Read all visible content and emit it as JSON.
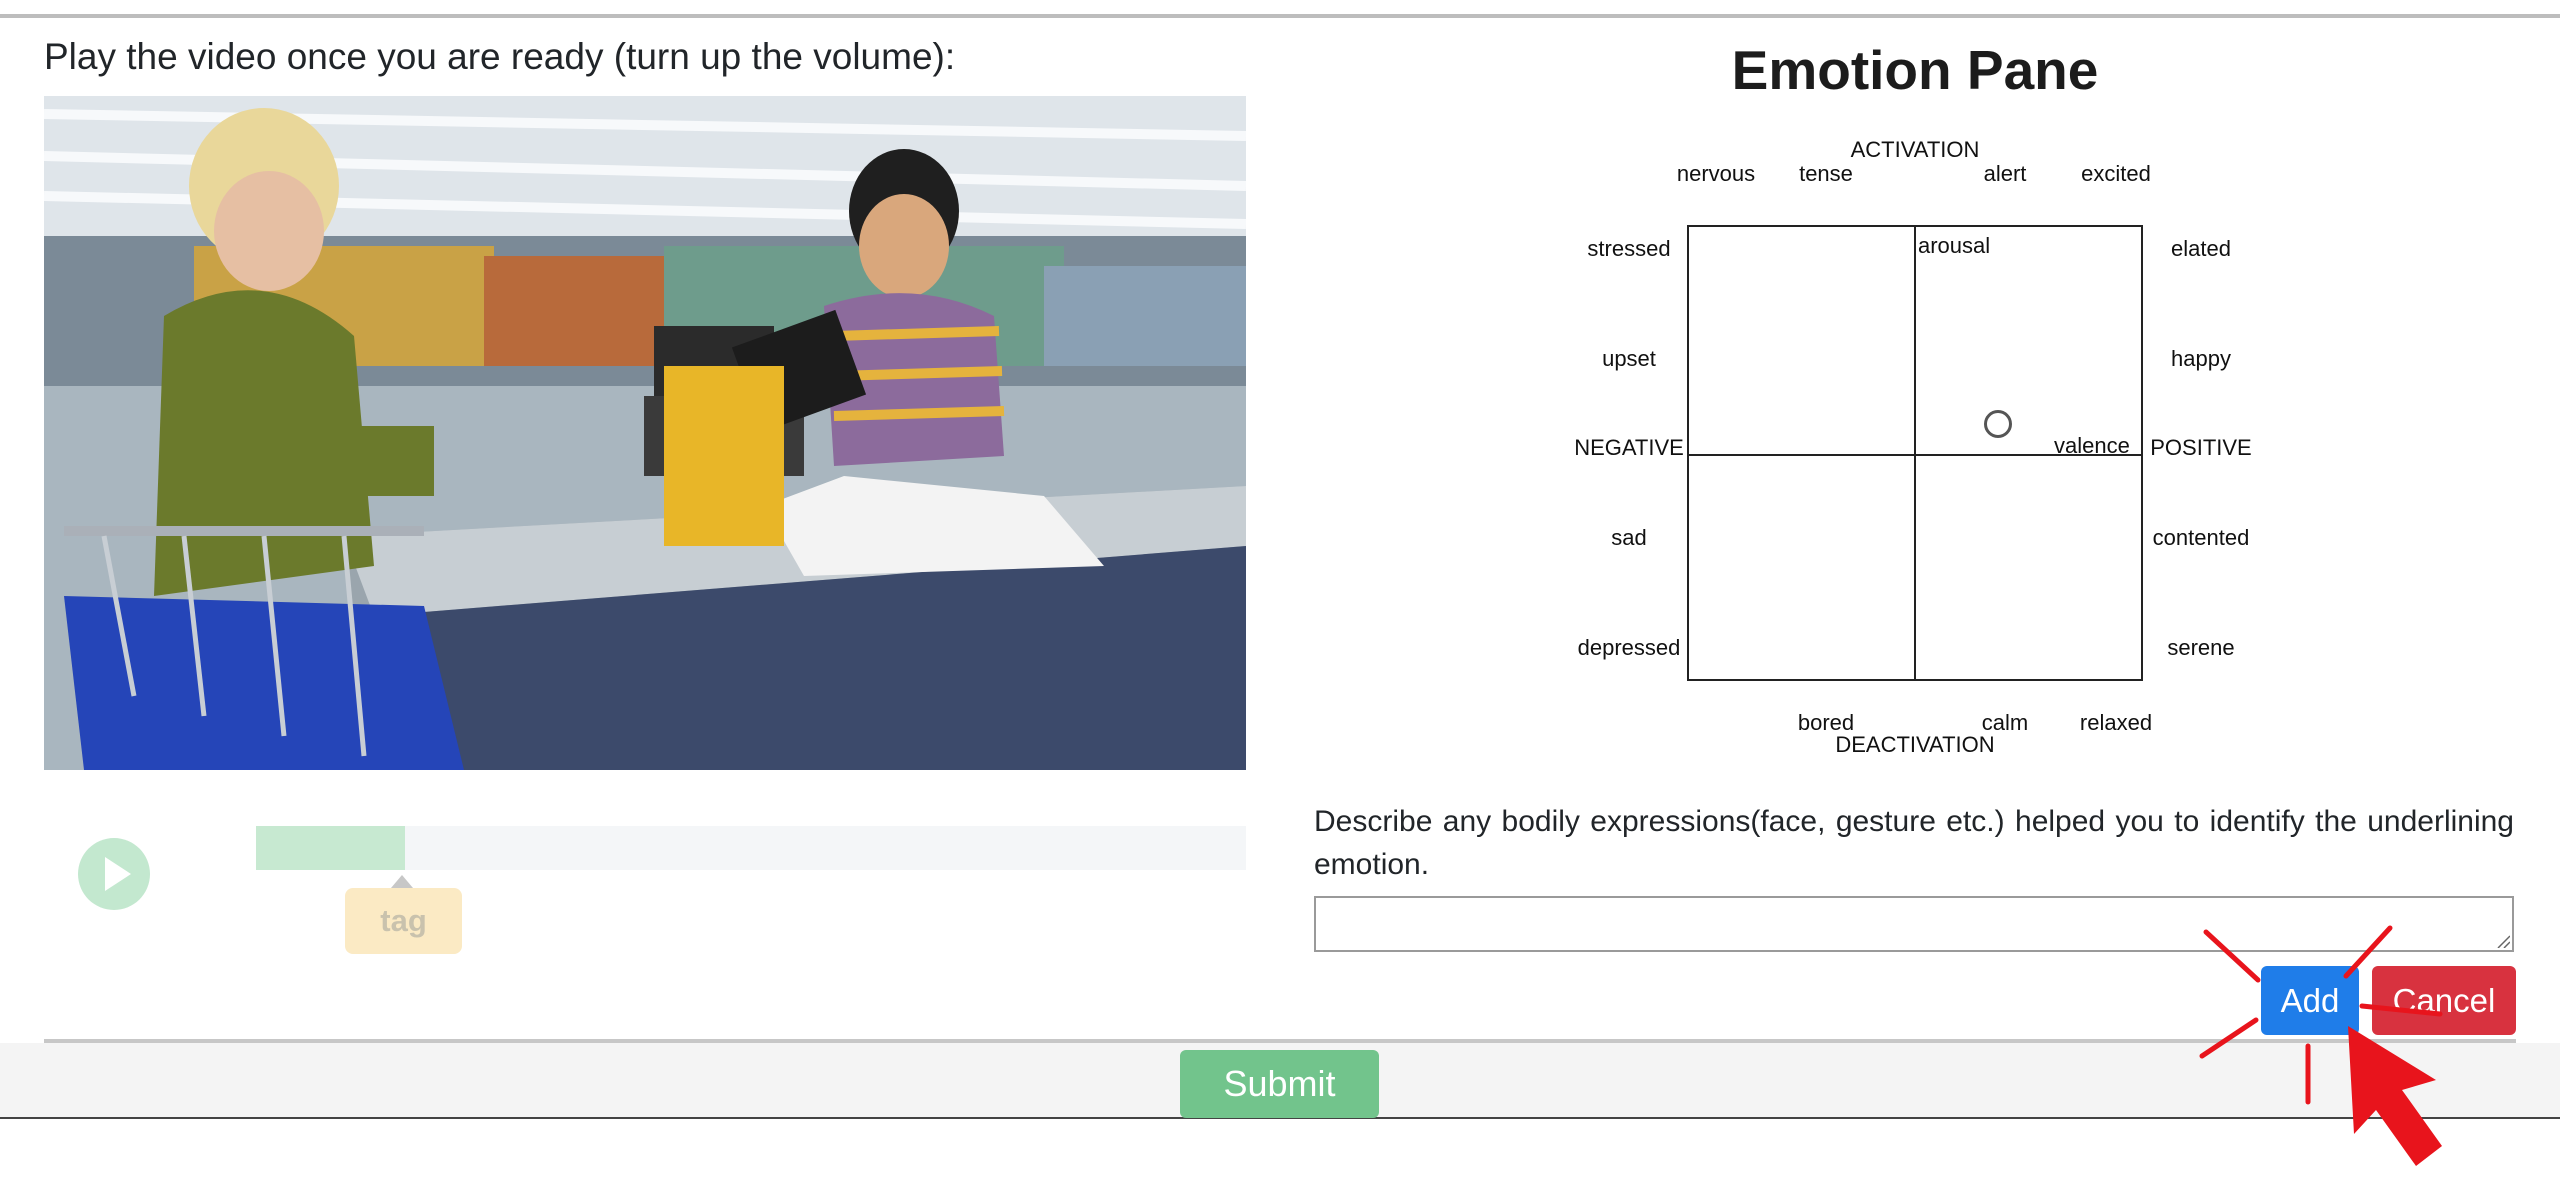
{
  "instruction": "Play the video once you are ready (turn up the volume):",
  "player": {
    "tag_label": "tag",
    "progress": 0.15
  },
  "emotion_pane": {
    "title": "Emotion Pane",
    "axis": {
      "top": "ACTIVATION",
      "bottom": "DEACTIVATION",
      "left": "NEGATIVE",
      "right": "POSITIVE",
      "inner_vertical": "arousal",
      "inner_horizontal": "valence"
    },
    "top_words": [
      "nervous",
      "tense",
      "alert",
      "excited"
    ],
    "bottom_words": [
      "bored",
      "calm",
      "relaxed"
    ],
    "left_words": [
      "stressed",
      "upset",
      "sad",
      "depressed"
    ],
    "right_words": [
      "elated",
      "happy",
      "contented",
      "serene"
    ]
  },
  "description": {
    "prompt": "Describe any bodily expressions(face, gesture etc.) helped you to identify the underlining emotion.",
    "value": ""
  },
  "buttons": {
    "add": "Add",
    "cancel": "Cancel",
    "submit": "Submit"
  },
  "colors": {
    "add": "#1f7de9",
    "cancel": "#d8323f",
    "submit": "#72c48c",
    "cursor": "#e8141c"
  }
}
